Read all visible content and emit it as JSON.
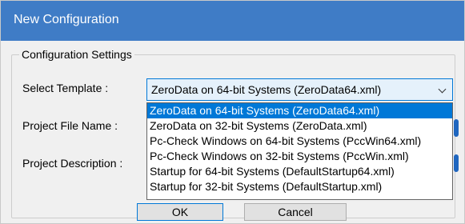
{
  "window": {
    "title": "New Configuration"
  },
  "group": {
    "title": "Configuration Settings"
  },
  "labels": {
    "select_template": "Select Template :",
    "project_file_name": "Project File Name :",
    "project_description": "Project Description :"
  },
  "combo": {
    "selected": "ZeroData on 64-bit Systems (ZeroData64.xml)",
    "options": [
      "ZeroData on 64-bit Systems (ZeroData64.xml)",
      "ZeroData on 32-bit Systems (ZeroData.xml)",
      "Pc-Check Windows on 64-bit Systems (PccWin64.xml)",
      "Pc-Check Windows on 32-bit Systems (PccWin.xml)",
      "Startup for 64-bit Systems (DefaultStartup64.xml)",
      "Startup for 32-bit Systems (DefaultStartup.xml)"
    ],
    "highlighted_index": 0
  },
  "buttons": {
    "ok": "OK",
    "cancel": "Cancel"
  },
  "colors": {
    "titlebar": "#3f7cc6",
    "selection": "#0078d7"
  }
}
